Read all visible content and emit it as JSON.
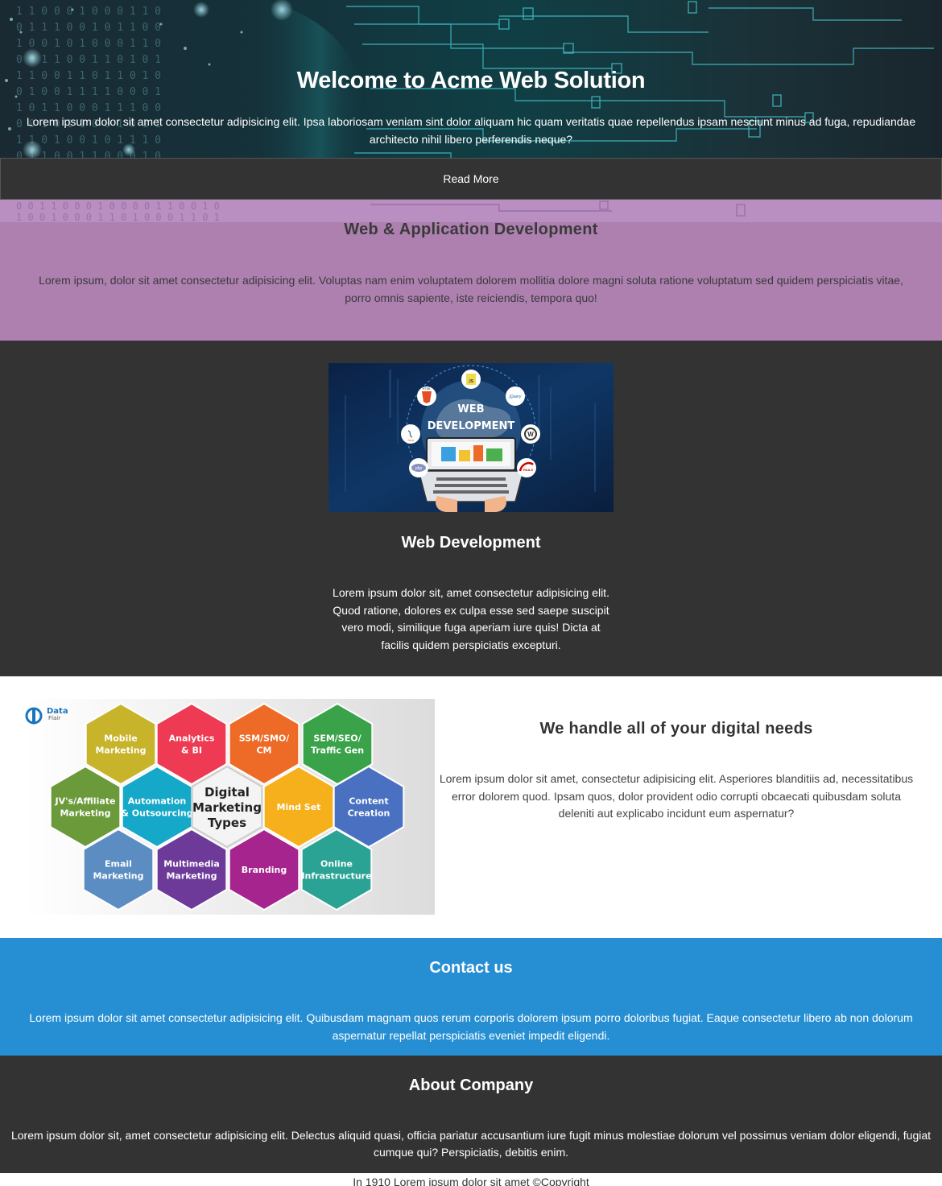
{
  "hero": {
    "title": "Welcome to Acme Web Solution",
    "text": "Lorem ipsum dolor sit amet consectetur adipisicing elit. Ipsa laboriosam veniam sint dolor aliquam hic quam veritatis quae repellendus ipsam nesciunt minus ad fuga, repudiandae architecto nihil libero perferendis neque?",
    "button_label": "Read More"
  },
  "web_app_section": {
    "title": "Web & Application Development",
    "text": "Lorem ipsum, dolor sit amet consectetur adipisicing elit. Voluptas nam enim voluptatem dolorem mollitia dolore magni soluta ratione voluptatum sed quidem perspiciatis vitae, porro omnis sapiente, iste reiciendis, tempora quo!",
    "background_color": "#ae80b0"
  },
  "web_dev_section": {
    "image": {
      "caption_line1": "WEB",
      "caption_line2": "DEVELOPMENT",
      "icons": [
        "html5-icon",
        "js-icon",
        "jquery-icon",
        "wordpress-icon",
        "java-icon",
        "php-icon",
        "rails-icon",
        "laptop-icon"
      ],
      "icon_labels": {
        "html5": "HTML",
        "js": "JS",
        "jquery": "jQuery",
        "java": "Java",
        "php": "php",
        "rails": "RAILS"
      }
    },
    "title": "Web Development",
    "text": "Lorem ipsum dolor sit, amet consectetur adipisicing elit. Quod ratione, dolores ex culpa esse sed saepe suscipit vero modi, similique fuga aperiam iure quis! Dicta at facilis quidem perspiciatis excepturi."
  },
  "digital_section": {
    "image": {
      "brand": "Data",
      "brand_sub": "Flair",
      "center_label": [
        "Digital",
        "Marketing",
        "Types"
      ],
      "hexagons": [
        {
          "label": [
            "Mobile",
            "Marketing"
          ],
          "color": "#c8b42a"
        },
        {
          "label": [
            "Analytics",
            "& BI"
          ],
          "color": "#ee3a52"
        },
        {
          "label": [
            "SSM/SMO/",
            "CM"
          ],
          "color": "#ee6a27"
        },
        {
          "label": [
            "SEM/SEO/",
            "Traffic Gen"
          ],
          "color": "#3aa34a"
        },
        {
          "label": [
            "JV's/Affiliate",
            "Marketing"
          ],
          "color": "#6b9a3a"
        },
        {
          "label": [
            "Automation",
            "& Outsourcing"
          ],
          "color": "#16a8c8"
        },
        {
          "label": [
            "Mind Set"
          ],
          "color": "#f6b01b"
        },
        {
          "label": [
            "Content",
            "Creation"
          ],
          "color": "#4a70c2"
        },
        {
          "label": [
            "Email",
            "Marketing"
          ],
          "color": "#5b8dc2"
        },
        {
          "label": [
            "Multimedia",
            "Marketing"
          ],
          "color": "#6d3a9a"
        },
        {
          "label": [
            "Branding"
          ],
          "color": "#a6248e"
        },
        {
          "label": [
            "Online",
            "Infrastructure"
          ],
          "color": "#2aa294"
        }
      ]
    },
    "title": "We handle all of your digital needs",
    "text": "Lorem ipsum dolor sit amet, consectetur adipisicing elit. Asperiores blanditiis ad, necessitatibus error dolorem quod. Ipsam quos, dolor provident odio corrupti obcaecati quibusdam soluta deleniti aut explicabo incidunt eum aspernatur?"
  },
  "contact_section": {
    "title": "Contact us",
    "text": "Lorem ipsum dolor sit amet consectetur adipisicing elit. Quibusdam magnam quos rerum corporis dolorem ipsum porro doloribus fugiat. Eaque consectetur libero ab non dolorum aspernatur repellat perspiciatis eveniet impedit eligendi.",
    "background_color": "#268fd3"
  },
  "about_section": {
    "title": "About Company",
    "text": "Lorem ipsum dolor sit, amet consectetur adipisicing elit. Delectus aliquid quasi, officia pariatur accusantium iure fugit minus molestiae dolorum vel possimus veniam dolor eligendi, fugiat cumque qui? Perspiciatis, debitis enim."
  },
  "footer": {
    "text": "In 1910 Lorem ipsum dolor sit amet ©Copyright"
  }
}
